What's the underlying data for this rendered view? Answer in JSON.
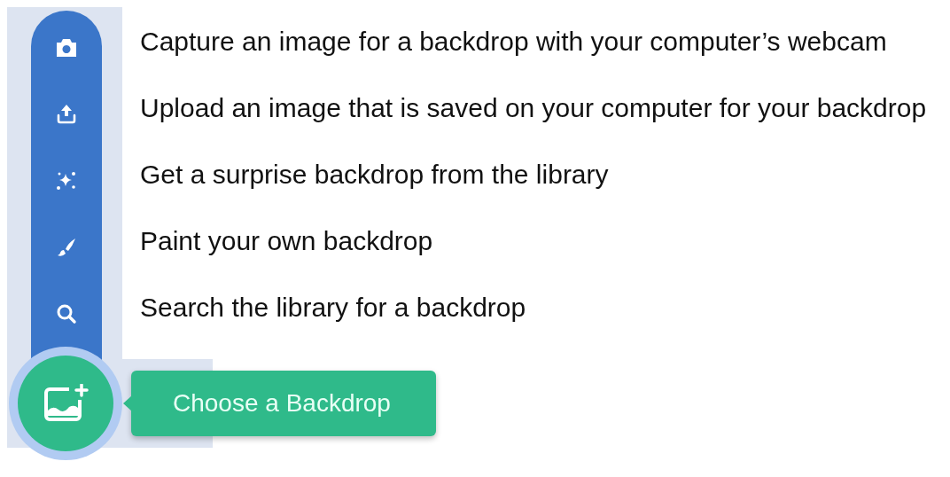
{
  "menu": [
    {
      "kind": "camera",
      "description": "Capture an image for a backdrop with your computer’s webcam"
    },
    {
      "kind": "upload",
      "description": "Upload an image that is saved on your computer for your backdrop"
    },
    {
      "kind": "surprise",
      "description": "Get a surprise backdrop from the library"
    },
    {
      "kind": "paint",
      "description": "Paint your own backdrop"
    },
    {
      "kind": "search",
      "description": "Search the library for a backdrop"
    }
  ],
  "tooltip": {
    "label": "Choose a Backdrop"
  }
}
